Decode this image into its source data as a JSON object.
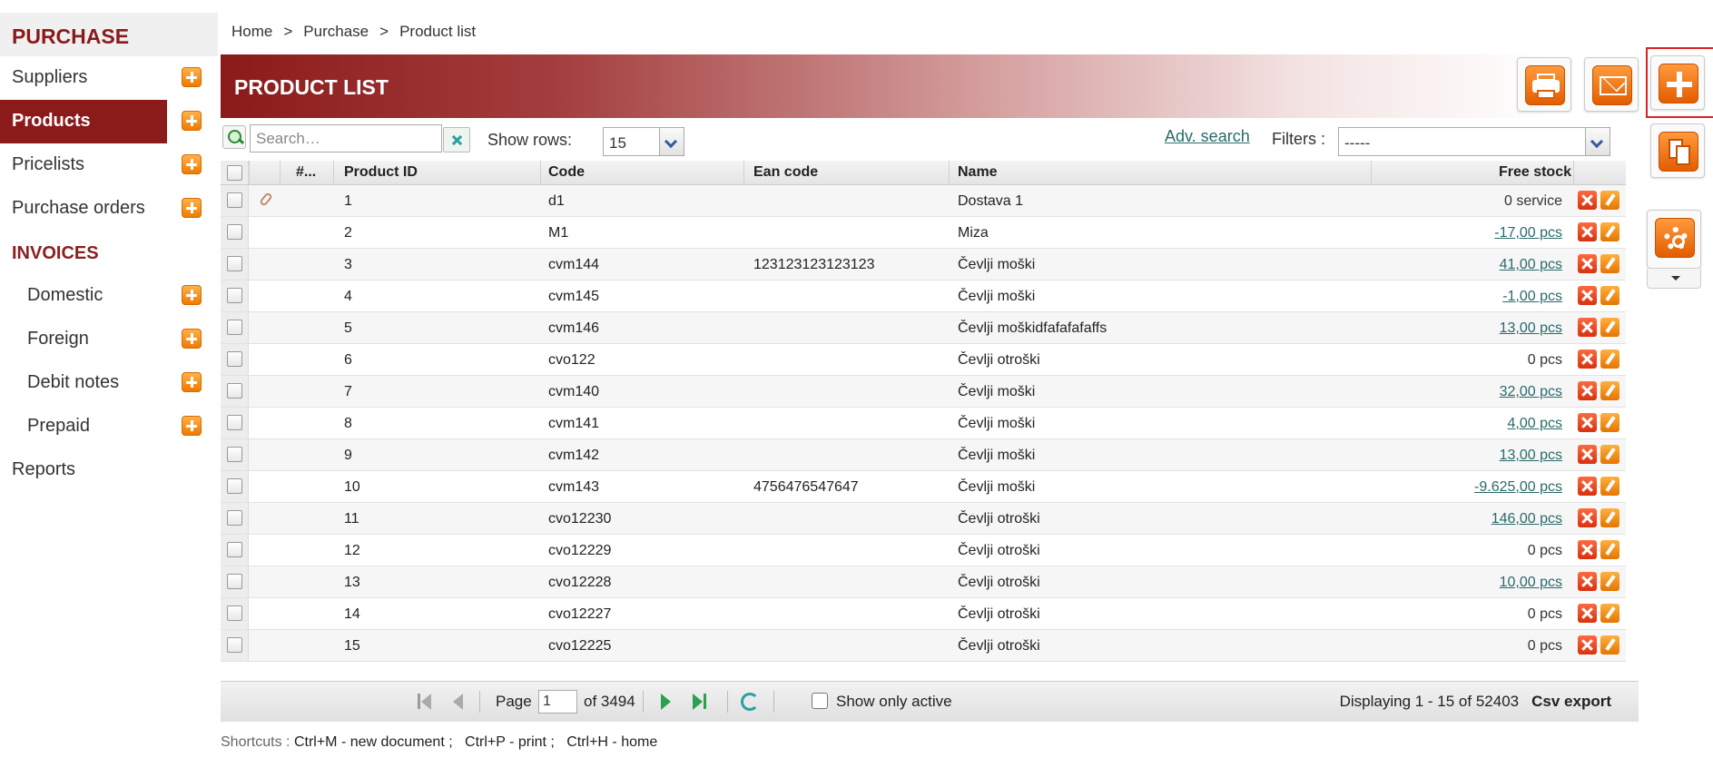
{
  "sidebar": {
    "section_purchase": "PURCHASE",
    "purchase_items": [
      {
        "label": "Suppliers"
      },
      {
        "label": "Products"
      },
      {
        "label": "Pricelists"
      },
      {
        "label": "Purchase orders"
      }
    ],
    "section_invoices": "INVOICES",
    "invoice_items": [
      {
        "label": "Domestic"
      },
      {
        "label": "Foreign"
      },
      {
        "label": "Debit notes"
      },
      {
        "label": "Prepaid"
      }
    ],
    "reports": "Reports"
  },
  "breadcrumb": {
    "home": "Home",
    "purchase": "Purchase",
    "current": "Product list",
    "sep": ">"
  },
  "header": {
    "title": "PRODUCT LIST"
  },
  "toolbar": {
    "search_placeholder": "Search…",
    "show_rows_label": "Show rows:",
    "rows_value": "15",
    "adv_search": "Adv. search",
    "filters_label": "Filters :",
    "filters_value": "-----"
  },
  "table": {
    "columns": [
      "#...",
      "Product ID",
      "Code",
      "Ean code",
      "Name",
      "Free stock"
    ],
    "rows": [
      {
        "id": "1",
        "code": "d1",
        "ean": "",
        "name": "Dostava 1",
        "stock": "0 service",
        "link": false,
        "attach": true
      },
      {
        "id": "2",
        "code": "M1",
        "ean": "",
        "name": "Miza",
        "stock": "-17,00 pcs",
        "link": true
      },
      {
        "id": "3",
        "code": "cvm144",
        "ean": "123123123123123",
        "name": "Čevlji moški",
        "stock": "41,00 pcs",
        "link": true
      },
      {
        "id": "4",
        "code": "cvm145",
        "ean": "",
        "name": "Čevlji moški",
        "stock": "-1,00 pcs",
        "link": true
      },
      {
        "id": "5",
        "code": "cvm146",
        "ean": "",
        "name": "Čevlji moškidfafafafaffs",
        "stock": "13,00 pcs",
        "link": true
      },
      {
        "id": "6",
        "code": "cvo122",
        "ean": "",
        "name": "Čevlji otroški",
        "stock": "0 pcs",
        "link": false
      },
      {
        "id": "7",
        "code": "cvm140",
        "ean": "",
        "name": "Čevlji moški",
        "stock": "32,00 pcs",
        "link": true
      },
      {
        "id": "8",
        "code": "cvm141",
        "ean": "",
        "name": "Čevlji moški",
        "stock": "4,00 pcs",
        "link": true
      },
      {
        "id": "9",
        "code": "cvm142",
        "ean": "",
        "name": "Čevlji moški",
        "stock": "13,00 pcs",
        "link": true
      },
      {
        "id": "10",
        "code": "cvm143",
        "ean": "4756476547647",
        "name": "Čevlji moški",
        "stock": "-9.625,00 pcs",
        "link": true
      },
      {
        "id": "11",
        "code": "cvo12230",
        "ean": "",
        "name": "Čevlji otroški",
        "stock": "146,00 pcs",
        "link": true
      },
      {
        "id": "12",
        "code": "cvo12229",
        "ean": "",
        "name": "Čevlji otroški",
        "stock": "0 pcs",
        "link": false
      },
      {
        "id": "13",
        "code": "cvo12228",
        "ean": "",
        "name": "Čevlji otroški",
        "stock": "10,00 pcs",
        "link": true
      },
      {
        "id": "14",
        "code": "cvo12227",
        "ean": "",
        "name": "Čevlji otroški",
        "stock": "0 pcs",
        "link": false
      },
      {
        "id": "15",
        "code": "cvo12225",
        "ean": "",
        "name": "Čevlji otroški",
        "stock": "0 pcs",
        "link": false
      }
    ]
  },
  "pager": {
    "page_label": "Page",
    "page_value": "1",
    "of_label": "of 3494",
    "show_active": "Show only active",
    "displaying": "Displaying 1 - 15 of 52403",
    "csv": "Csv export"
  },
  "shortcuts": {
    "label": "Shortcuts :",
    "items": [
      "Ctrl+M - new document ;",
      "Ctrl+P - print ;",
      "Ctrl+H - home"
    ]
  },
  "icons": {
    "print": "printer-icon",
    "mail": "mail-icon",
    "add": "plus-icon",
    "copy": "copy-icon",
    "settings": "gear-icon"
  },
  "colors": {
    "brand": "#8b1a1a",
    "accent": "#f07a00",
    "link": "#2a6a6a"
  }
}
